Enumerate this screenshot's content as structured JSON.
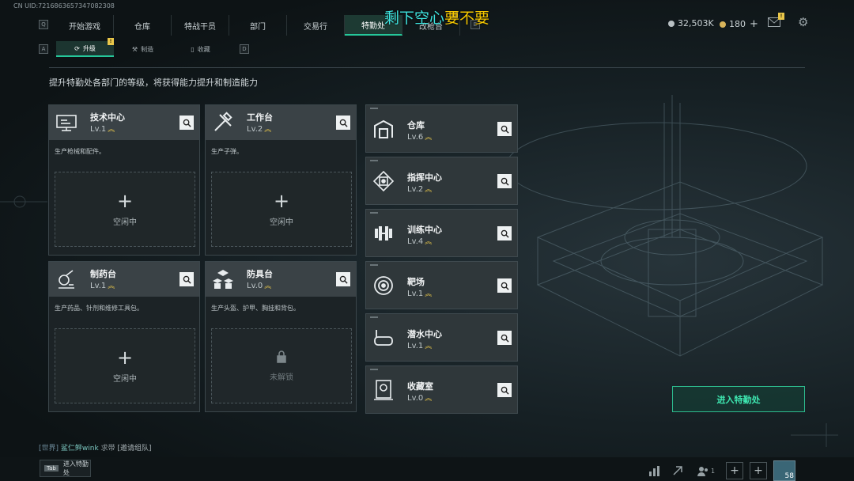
{
  "uid": "CN UID:7216863657347082308",
  "overlay": {
    "part1": "剩下空心",
    "part2": "要不要"
  },
  "main_tabs": [
    {
      "label": "开始游戏"
    },
    {
      "label": "仓库"
    },
    {
      "label": "特战干员"
    },
    {
      "label": "部门"
    },
    {
      "label": "交易行"
    },
    {
      "label": "特勤处",
      "active": true
    },
    {
      "label": "改枪台"
    }
  ],
  "key_hints": {
    "left": "Q",
    "right": "E",
    "sub_left": "A",
    "sub_right": "D"
  },
  "currency": {
    "money": "32,503K",
    "coupon": "180",
    "plus": "+"
  },
  "sub_tabs": [
    {
      "label": "升级",
      "active": true
    },
    {
      "label": "制造"
    },
    {
      "label": "收藏"
    }
  ],
  "description": "提升特勤处各部门的等级，将获得能力提升和制造能力",
  "facilities_big": [
    {
      "name": "技术中心",
      "level": "Lv.1",
      "desc": "生产枪械和配件。",
      "slot": "空闲中",
      "icon": "tech-center-icon"
    },
    {
      "name": "工作台",
      "level": "Lv.2",
      "desc": "生产子弹。",
      "slot": "空闲中",
      "icon": "workbench-icon"
    },
    {
      "name": "制药台",
      "level": "Lv.1",
      "desc": "生产药品、针剂和维修工具包。",
      "slot": "空闲中",
      "icon": "pharmacy-icon"
    },
    {
      "name": "防具台",
      "level": "Lv.0",
      "desc": "生产头盔、护甲、胸挂和背包。",
      "slot": "未解锁",
      "icon": "armor-bench-icon"
    }
  ],
  "facilities_small": [
    {
      "name": "仓库",
      "level": "Lv.6",
      "icon": "warehouse-icon"
    },
    {
      "name": "指挥中心",
      "level": "Lv.2",
      "icon": "command-center-icon"
    },
    {
      "name": "训练中心",
      "level": "Lv.4",
      "icon": "training-center-icon"
    },
    {
      "name": "靶场",
      "level": "Lv.1",
      "icon": "shooting-range-icon"
    },
    {
      "name": "潜水中心",
      "level": "Lv.1",
      "icon": "diving-center-icon"
    },
    {
      "name": "收藏室",
      "level": "Lv.0",
      "icon": "collection-room-icon"
    }
  ],
  "enter_button": "进入特勤处",
  "chat": {
    "channel": "[世界]",
    "nick": "鲨仁鲆wink",
    "msg": "求带",
    "link": "[邀请组队]"
  },
  "bottom": {
    "tab_key": "Tab",
    "tab_label": "进入特勤处",
    "friends_count": "1",
    "level": "58",
    "plus": "+"
  },
  "colors": {
    "accent": "#25c79a",
    "gold": "#e8c64a"
  }
}
